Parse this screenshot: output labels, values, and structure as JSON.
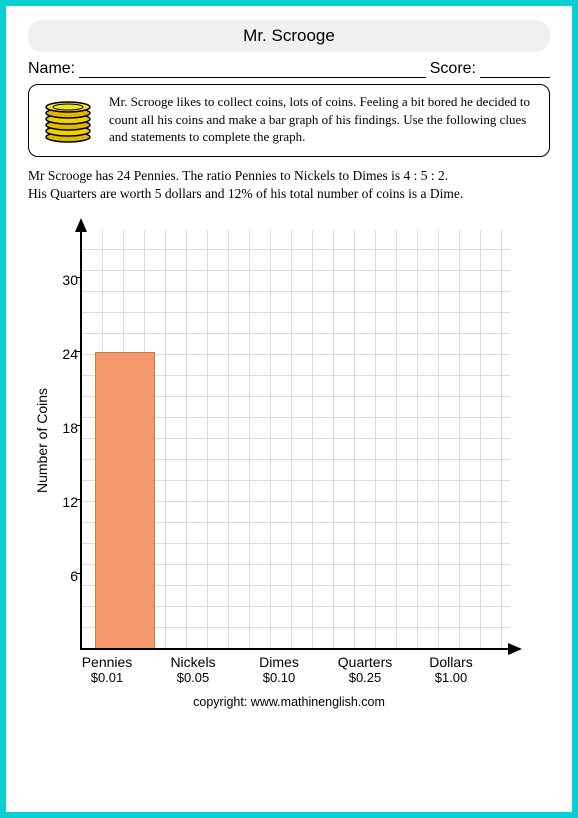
{
  "title": "Mr. Scrooge",
  "labels": {
    "name": "Name:",
    "score": "Score:"
  },
  "intro": "Mr. Scrooge likes to collect coins, lots of coins. Feeling a bit bored he decided to count all his coins and make a bar graph of his findings. Use the following clues and statements to complete the graph.",
  "problem_line1": "Mr Scrooge has 24 Pennies. The ratio Pennies to Nickels to Dimes is  4 : 5 : 2.",
  "problem_line2": "His Quarters are worth 5 dollars and 12% of his total number of coins is a Dime.",
  "copyright": "copyright:    www.mathinenglish.com",
  "chart_data": {
    "type": "bar",
    "ylabel": "Number of Coins",
    "ylim": [
      0,
      34
    ],
    "yticks": [
      6,
      12,
      18,
      24,
      30
    ],
    "categories": [
      {
        "name": "Pennies",
        "sub": "$0.01"
      },
      {
        "name": "Nickels",
        "sub": "$0.05"
      },
      {
        "name": "Dimes",
        "sub": "$0.10"
      },
      {
        "name": "Quarters",
        "sub": "$0.25"
      },
      {
        "name": "Dollars",
        "sub": "$1.00"
      }
    ],
    "values": [
      24,
      null,
      null,
      null,
      null
    ],
    "bar_color": "#f69a6e"
  }
}
